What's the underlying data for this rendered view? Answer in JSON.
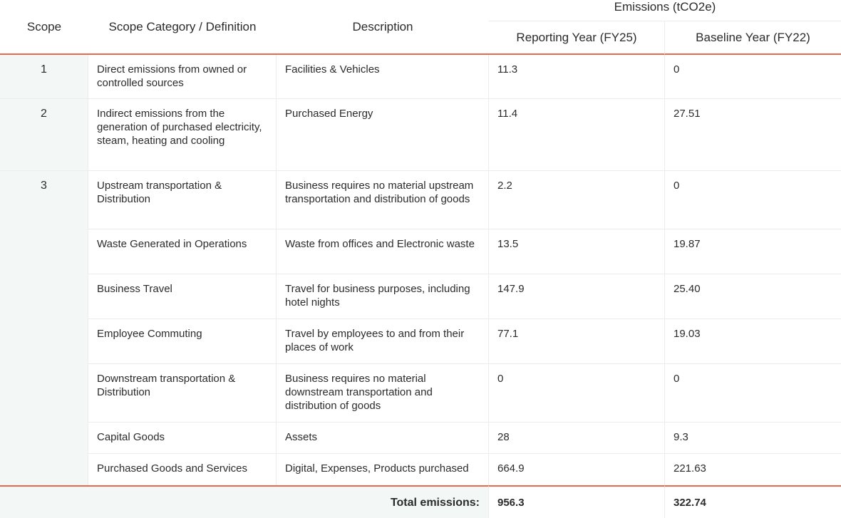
{
  "header": {
    "emissions_group": "Emissions (tCO2e)",
    "scope": "Scope",
    "category": "Scope Category / Definition",
    "description": "Description",
    "reporting": "Reporting Year (FY25)",
    "baseline": "Baseline Year (FY22)"
  },
  "rows": [
    {
      "category": "Direct emissions from owned or controlled sources",
      "description": "Facilities & Vehicles",
      "reporting": "11.3",
      "baseline": "0"
    },
    {
      "category": "Indirect emissions from the generation of purchased electricity, steam, heating and cooling",
      "description": "Purchased Energy",
      "reporting": "11.4",
      "baseline": "27.51"
    },
    {
      "category": "Upstream transportation & Distribution",
      "description": "Business requires no material upstream transportation and distribution of goods",
      "reporting": "2.2",
      "baseline": "0"
    },
    {
      "category": "Waste Generated in Operations",
      "description": "Waste from offices and Electronic waste",
      "reporting": "13.5",
      "baseline": "19.87"
    },
    {
      "category": "Business Travel",
      "description": "Travel for business purposes, including hotel nights",
      "reporting": "147.9",
      "baseline": "25.40"
    },
    {
      "category": "Employee Commuting",
      "description": "Travel by employees to and from their places of work",
      "reporting": "77.1",
      "baseline": "19.03"
    },
    {
      "category": "Downstream transportation & Distribution",
      "description": "Business requires no material downstream transportation and distribution of goods",
      "reporting": "0",
      "baseline": "0"
    },
    {
      "category": "Capital Goods",
      "description": "Assets",
      "reporting": "28",
      "baseline": "9.3"
    },
    {
      "category": "Purchased Goods and Services",
      "description": "Digital, Expenses, Products purchased",
      "reporting": "664.9",
      "baseline": "221.63"
    }
  ],
  "scopes": [
    "1",
    "2",
    "3"
  ],
  "total": {
    "label": "Total emissions:",
    "reporting": "956.3",
    "baseline": "322.74"
  },
  "colors": {
    "accent": "#e8694c",
    "scope_bg": "#f3f7f6"
  }
}
